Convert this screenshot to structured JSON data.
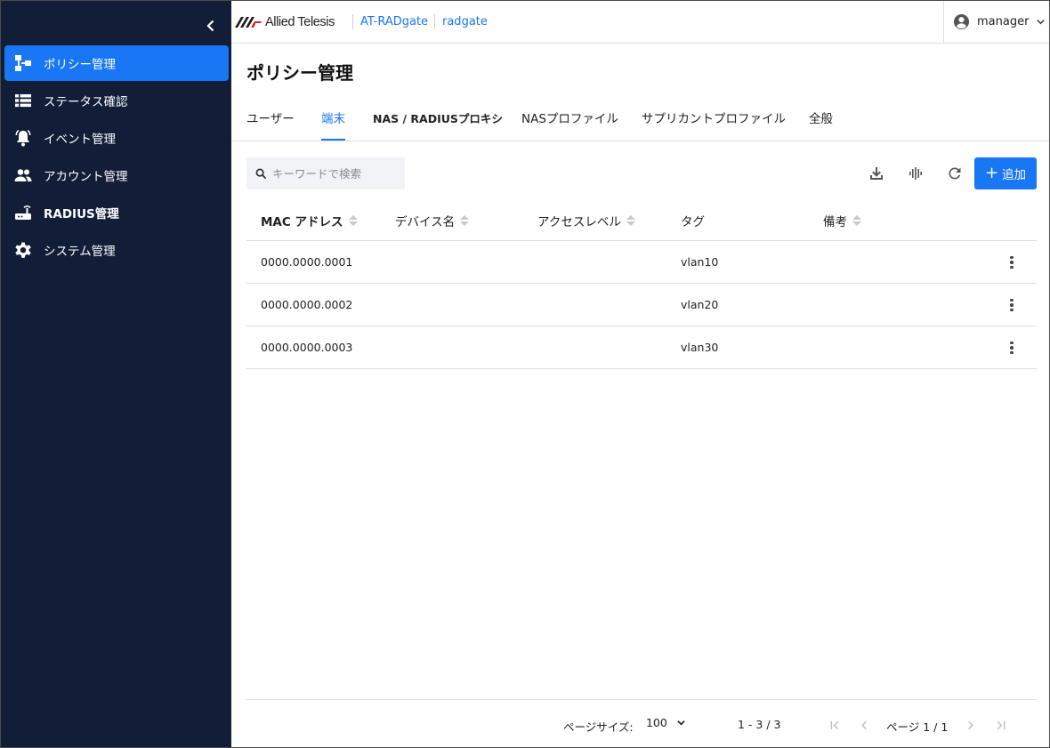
{
  "brand": {
    "logo_text": "Allied Telesis",
    "logo_colors": [
      "#1a1a1a",
      "#e02020"
    ]
  },
  "breadcrumb": {
    "product": "AT-RADgate",
    "host": "radgate"
  },
  "user": {
    "name": "manager",
    "icon": "account-circle-icon"
  },
  "sidebar": {
    "collapse_icon": "chevron-left-icon",
    "items": [
      {
        "label": "ポリシー管理",
        "icon": "policy-tree-icon",
        "active": true
      },
      {
        "label": "ステータス確認",
        "icon": "list-icon",
        "active": false
      },
      {
        "label": "イベント管理",
        "icon": "alarm-bell-icon",
        "active": false
      },
      {
        "label": "アカウント管理",
        "icon": "people-icon",
        "active": false
      },
      {
        "label": "RADIUS管理",
        "icon": "router-icon",
        "active": false
      },
      {
        "label": "システム管理",
        "icon": "gear-icon",
        "active": false
      }
    ]
  },
  "page": {
    "title": "ポリシー管理"
  },
  "tabs": [
    {
      "label": "ユーザー",
      "active": false
    },
    {
      "label": "端末",
      "active": true
    },
    {
      "label": "NAS / RADIUSプロキシ",
      "active": false
    },
    {
      "label": "NASプロファイル",
      "active": false
    },
    {
      "label": "サプリカントプロファイル",
      "active": false
    },
    {
      "label": "全般",
      "active": false
    }
  ],
  "toolbar": {
    "search_placeholder": "キーワードで検索",
    "search_value": "",
    "add_label": "追加",
    "icons": [
      "download-icon",
      "audio-wave-icon",
      "refresh-icon",
      "plus-icon"
    ]
  },
  "table": {
    "columns": [
      "MAC アドレス",
      "デバイス名",
      "アクセスレベル",
      "タグ",
      "備考"
    ],
    "rows": [
      {
        "mac": "0000.0000.0001",
        "device": "",
        "access": "",
        "tag": "vlan10",
        "note": ""
      },
      {
        "mac": "0000.0000.0002",
        "device": "",
        "access": "",
        "tag": "vlan20",
        "note": ""
      },
      {
        "mac": "0000.0000.0003",
        "device": "",
        "access": "",
        "tag": "vlan30",
        "note": ""
      }
    ]
  },
  "pagination": {
    "page_size_label": "ページサイズ:",
    "page_size": "100",
    "range": "1 - 3 / 3",
    "page_label": "ページ 1 / 1"
  },
  "colors": {
    "sidebar_bg": "#121e38",
    "accent": "#1976f5",
    "text": "#212121",
    "divider": "#e0e0e0"
  }
}
